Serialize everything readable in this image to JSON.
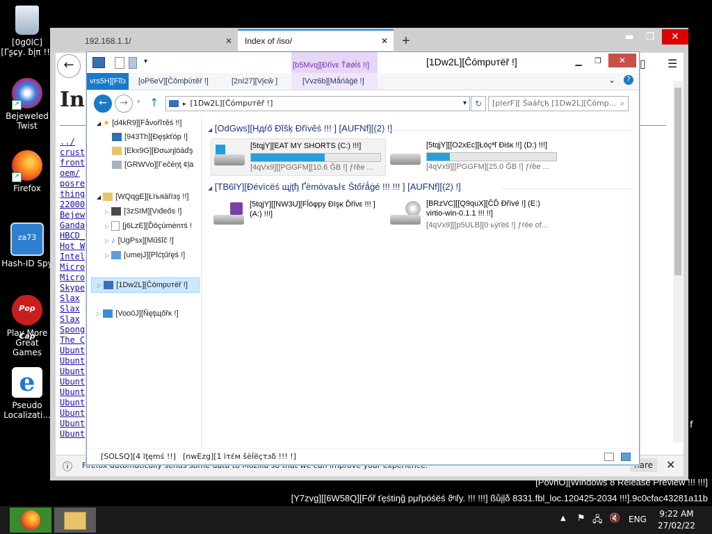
{
  "desktop": {
    "icons": [
      {
        "label": "[0g0lC][Γʂɕу. ƀįπ !!]",
        "icon": "recycle-bin-icon"
      },
      {
        "label": "Bejeweled Twist",
        "icon": "bejeweled-icon"
      },
      {
        "label": "Firefox",
        "icon": "firefox-icon"
      },
      {
        "label": "Hash-ID Spy",
        "icon": "hash-id-spy-icon"
      },
      {
        "label": "Play More Great Games",
        "icon": "popcap-icon"
      },
      {
        "label": "Pseudo Localizati...",
        "icon": "ie-icon"
      }
    ],
    "watermark_line1": "[PovhO][Windows 8 Release Preview !!! !!!]",
    "watermark_line2": "[Y7zvg][[6W58Q][Főř ťęśtiŋğ pμřpóśëś ϑᶯľy. !!! !!!] ßůįļδ 8331.fbl_loc.120425-2034 !!!].9c0cfac43281a11b",
    "stray_char": "f"
  },
  "firefox": {
    "tabs": [
      {
        "label": "192.168.1.1/"
      },
      {
        "label": "Index of /iso/"
      }
    ],
    "new_tab": "+",
    "page_heading": "Ind",
    "listing": [
      "../",
      "crust",
      "front",
      "oem/",
      "posre",
      "thing",
      "22000",
      "Bejew",
      "Ganda",
      "HBCD_",
      "Hot W",
      "Intel",
      "Micro",
      "Micro",
      "Skype",
      "Slax ",
      "Slax ",
      "Slax ",
      "Spong",
      "The C",
      "Ubunt",
      "Ubunt",
      "Ubunt",
      "Ubunt",
      "Ubunt",
      "Ubunt",
      "Ubunt",
      "Ubunt",
      "Ubunt"
    ],
    "notification": "Firefox automatically sends some data to Mozilla so that we can improve your experience.",
    "share_btn": "hare"
  },
  "explorer": {
    "title": "[1Dw2L][Ĉómpυтëř !]",
    "ribbon": {
      "context_tab": "[b5Mvq][Ðřίvε Ťǿǿĺś !!]",
      "tabs": [
        "vrs5H][Fĩl϶",
        "[oP6eV][Čŏmþύτĕř !]",
        "[2nI27][Vįєŵ ]",
        "[Vvz6b][Mǻńāġë !]"
      ]
    },
    "address": "[1Dw2L][Ĉómpυтëř !]",
    "search_placeholder": "[plerF][ Śəářçђ [1Dw2L][Ĉómp...",
    "nav": [
      {
        "label": "[d4kR9][Fåνořĭτĕś !!]",
        "icon": "star-icon"
      },
      {
        "label": "[943Th][Ðęşkťóp !]",
        "icon": "desktop-icon"
      },
      {
        "label": "[Ekx9G][Ðσωŋļöáďş",
        "icon": "downloads-icon"
      },
      {
        "label": "[GRWVo][Γеĉėņţ ¢ļа",
        "icon": "recent-icon"
      },
      {
        "label": "[WQqgE][Łïъяäřïзş !!]",
        "icon": "libraries-icon"
      },
      {
        "label": "[3zSIM][Vιđеős !]",
        "icon": "videos-icon"
      },
      {
        "label": "[j6LzE][Ďôçūmėnτś !",
        "icon": "documents-icon"
      },
      {
        "label": "[UgPsx][Műŝĭč !]",
        "icon": "music-icon"
      },
      {
        "label": "[umejJ][Pĭćţűŕęś !]",
        "icon": "pictures-icon"
      },
      {
        "label": "[1Dw2L][Ĉómpυтëř !]",
        "icon": "computer-icon"
      },
      {
        "label": "[Voo0J][Ňęţщőřĸ !]",
        "icon": "network-icon"
      }
    ],
    "groups": [
      {
        "header": "[OdGws][Hдŕő Ðĩŝķ Ðřїvĕś !!! ] [AUFNf][(2) !]",
        "drives": [
          {
            "name": "[5tqjY][EAT MY SHORTS (C:) !!!]",
            "free": "[4qVx9][[PGGFM][10.6 ĞB !] ƒŕȅe ...",
            "used_fraction": 0.57,
            "icon": "windows-drive-icon"
          },
          {
            "name": "[5tqjY][[O2xEc][Łöçªľ Ðiśк !!] (D:) !!!]",
            "free": "[4qVx9][[PGGFM][25.0 ĞB !] ƒŕȅe ...",
            "used_fraction": 0.18,
            "icon": "hard-drive-icon"
          }
        ]
      },
      {
        "header": "[TB6lY][Ðévïcëś щįţђ Ґëmóvaъŀε Śtőŕǻġé !!! !!! ] [AUFNf][(2) !]",
        "drives": [
          {
            "name": "[5tqjY][[NW3U][Fĺóφpу Ðїşĸ Ďřίνε !!! ] (A:) !!!]",
            "icon": "floppy-drive-icon"
          },
          {
            "name": "[BRzVC][[Q9quX][ĈĎ Ðřïvé !] (E:)",
            "name2": "virtio-win-0.1.1 !!! !!]",
            "free": "[4qVx9][[p5ULB][0 ьýťëś !] ƒŕée оf...",
            "icon": "cd-drive-icon"
          }
        ]
      }
    ],
    "status": {
      "count": "[SOLSQ][4 ïţęmś !!]",
      "selected": "[nwEzg][1 ìτέм šèĺëçτзδ !!! !]"
    }
  },
  "taskbar": {
    "clock_time": "9:22 AM",
    "clock_date": "27/02/22",
    "lang": "ENG"
  }
}
